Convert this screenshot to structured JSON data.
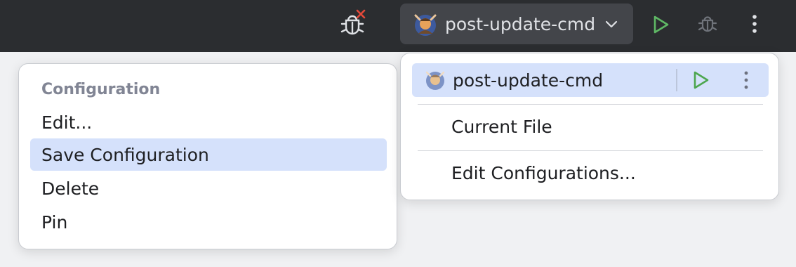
{
  "toolbar": {
    "config_name": "post-update-cmd",
    "icons": [
      "debug-error-icon",
      "avatar-icon",
      "chevron-down-icon",
      "run-icon",
      "debug-icon",
      "more-vertical-icon"
    ],
    "colors": {
      "background": "#2b2d30",
      "run_green": "#5fb865",
      "error_red": "#e5493a"
    }
  },
  "context_menu": {
    "header": "Configuration",
    "items": [
      "Edit...",
      "Save Configuration",
      "Delete",
      "Pin"
    ],
    "selected_index": 1
  },
  "run_popup": {
    "current_config": "post-update-cmd",
    "items": [
      "Current File",
      "Edit Configurations..."
    ],
    "colors": {
      "selection": "#d5e1fb"
    }
  }
}
